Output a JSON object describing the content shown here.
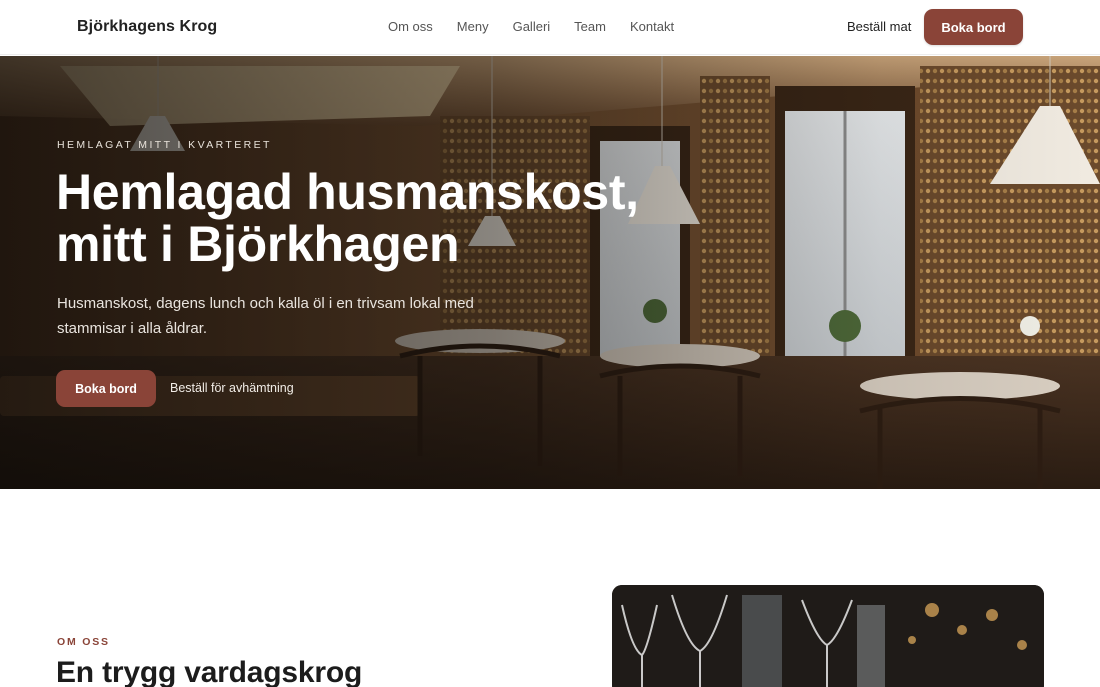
{
  "header": {
    "logo": "Björkhagens Krog",
    "nav": [
      "Om oss",
      "Meny",
      "Galleri",
      "Team",
      "Kontakt"
    ],
    "order_label": "Beställ mat",
    "book_label": "Boka bord"
  },
  "hero": {
    "eyebrow": "HEMLAGAT MITT I KVARTERET",
    "title": "Hemlagad husmanskost, mitt i Björkhagen",
    "subtitle": "Husmanskost, dagens lunch och kalla öl i en trivsam lokal med stammisar i alla åldrar.",
    "primary_cta": "Boka bord",
    "secondary_cta": "Beställ för avhämtning"
  },
  "about": {
    "eyebrow": "OM OSS",
    "title": "En trygg vardagskrog"
  },
  "colors": {
    "accent": "#8a4438",
    "text_dark": "#1f1f1f",
    "nav_text": "#555555"
  }
}
